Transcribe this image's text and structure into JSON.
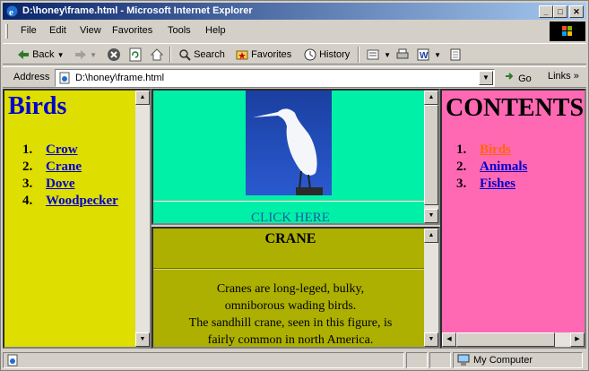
{
  "window": {
    "title": "D:\\honey\\frame.html - Microsoft Internet Explorer"
  },
  "menu": [
    "File",
    "Edit",
    "View",
    "Favorites",
    "Tools",
    "Help"
  ],
  "toolbar": {
    "back": "Back",
    "search": "Search",
    "favorites": "Favorites",
    "history": "History"
  },
  "address": {
    "label": "Address",
    "value": "D:\\honey\\frame.html",
    "go": "Go",
    "links": "Links"
  },
  "left_frame": {
    "heading": "Birds",
    "items": [
      {
        "num": "1.",
        "label": "Crow"
      },
      {
        "num": "2.",
        "label": "Crane"
      },
      {
        "num": "3.",
        "label": "Dove"
      },
      {
        "num": "4.",
        "label": "Woodpecker"
      }
    ],
    "bg": "#dede00"
  },
  "top_middle_frame": {
    "link": "CLICK HERE",
    "bg": "#00f0a8"
  },
  "bottom_middle_frame": {
    "heading": "CRANE",
    "desc_lines": [
      "Cranes are long-leged, bulky,",
      "omniborous wading birds.",
      "The sandhill crane, seen in this figure, is",
      "fairly common in north America."
    ],
    "bg": "#adb000"
  },
  "right_frame": {
    "heading": "CONTENTS",
    "items": [
      {
        "num": "1.",
        "label": "Birds",
        "color": "#ff6600"
      },
      {
        "num": "2.",
        "label": "Animals",
        "color": "#0000cc"
      },
      {
        "num": "3.",
        "label": "Fishes",
        "color": "#0000cc"
      }
    ],
    "bg": "#ff69b4"
  },
  "status": {
    "zone": "My Computer"
  }
}
